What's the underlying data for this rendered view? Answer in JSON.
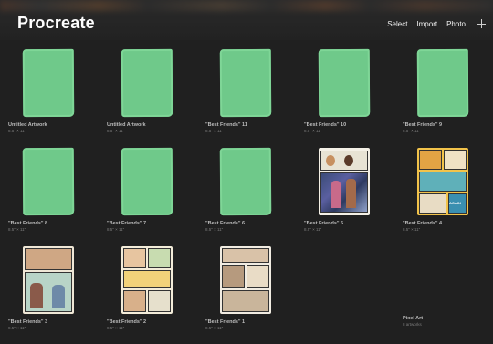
{
  "header": {
    "title": "Procreate",
    "actions": {
      "select": "Select",
      "import": "Import",
      "photo": "Photo"
    }
  },
  "colors": {
    "background": "#202020",
    "placeholder_green": "#6fc98a",
    "text": "#ffffff"
  },
  "gallery": {
    "items": [
      {
        "name": "Untitled Artwork",
        "size": "8.5\" × 11\""
      },
      {
        "name": "Untitled Artwork",
        "size": "8.5\" × 11\""
      },
      {
        "name": "\"Best Friends\" 11",
        "size": "8.5\" × 11\""
      },
      {
        "name": "\"Best Friends\" 10",
        "size": "8.5\" × 11\""
      },
      {
        "name": "\"Best Friends\" 9",
        "size": "8.5\" × 11\""
      },
      {
        "name": "\"Best Friends\" 8",
        "size": "8.5\" × 11\""
      },
      {
        "name": "\"Best Friends\" 7",
        "size": "8.5\" × 11\""
      },
      {
        "name": "\"Best Friends\" 6",
        "size": "8.5\" × 11\""
      },
      {
        "name": "\"Best Friends\" 5",
        "size": "8.5\" × 11\""
      },
      {
        "name": "\"Best Friends\" 4",
        "size": "8.5\" × 11\"",
        "panel_text": "AGAIN"
      },
      {
        "name": "\"Best Friends\" 3",
        "size": "8.5\" × 11\""
      },
      {
        "name": "\"Best Friends\" 2",
        "size": "8.5\" × 11\""
      },
      {
        "name": "\"Best Friends\" 1",
        "size": "8.5\" × 11\""
      },
      {
        "name": "Pixel Art",
        "size": "8 artworks"
      }
    ]
  }
}
